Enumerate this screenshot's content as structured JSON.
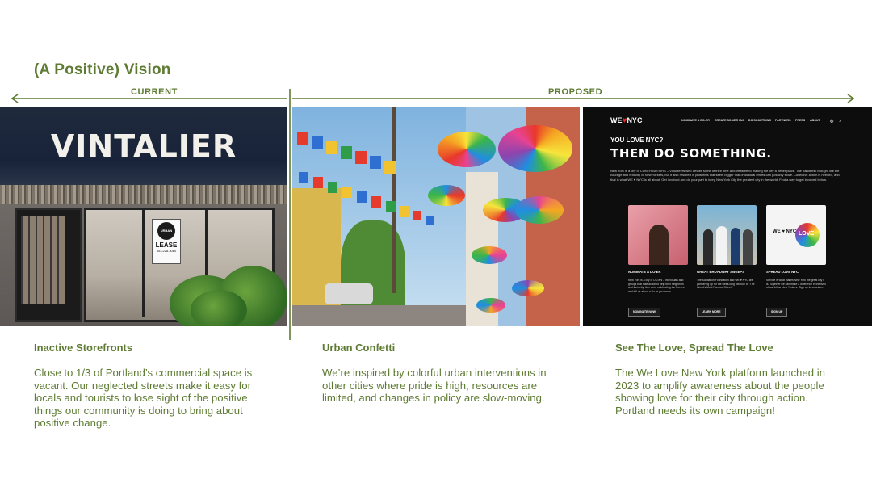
{
  "title": "(A Positive) Vision",
  "labels": {
    "current": "CURRENT",
    "proposed": "PROPOSED"
  },
  "storefront": {
    "sign": "VINTALIER",
    "lease_sign": {
      "logo": "URBAN WORKS",
      "text": "LEASE",
      "phone": "503.228.3060"
    }
  },
  "website": {
    "logo": "WE",
    "logo_heart": "♥",
    "logo_city": "NYC",
    "nav": [
      "NOMINATE A DO-ER",
      "CREATE SOMETHING",
      "DO SOMETHING",
      "PARTNERS",
      "PRESS",
      "ABOUT"
    ],
    "heading_small": "YOU LOVE NYC?",
    "heading_large": "THEN DO SOMETHING.",
    "body": "New York is a city of CONTRIBUTORS – Volunteers who devote some of their time and treasure to making the city a better place. The pandemic brought out the courage and tenacity of New Yorkers, but it also resulted in problems that seem bigger than individual efforts can possibly solve. Collective action is needed, and that is what WE ♥ NYC is all about. Get involved and do your part to keep New York City the greatest city in the world. Find a way to get involved below.",
    "cards": [
      {
        "title": "NOMINATE A DO-ER",
        "text": "New York is a city of DO-ers – individuals and groups that take action to help their neighbors and their city. Join us in celebrating the Do-ers and tell us about a Do-er you know.",
        "button": "NOMINATE NOW"
      },
      {
        "title": "GREAT BROADWAY SWEEPS",
        "text": "The Sanitation Foundation and WE ♥ NYC are partnering up for the week-long cleanup of \"The World's Most Famous Street.\"",
        "button": "LEARN MORE"
      },
      {
        "title": "SPREAD LOVE NYC",
        "text": "Service is what makes New York the great city it is. Together we can make a difference in the lives of our fellow New Yorkers. Sign up to volunteer.",
        "button": "SIGN UP"
      }
    ],
    "card_logo": "WE ♥ NYC",
    "card_love": "LOVE"
  },
  "sections": [
    {
      "title": "Inactive Storefronts",
      "body": "Close to 1/3 of Portland’s commercial space is vacant. Our neglected streets make it easy for locals and tourists to lose sight of the positive things our community is doing to bring about positive change."
    },
    {
      "title": "Urban Confetti",
      "body": "We’re inspired by colorful urban interventions in other cities where pride is high, resources are limited, and changes in policy are slow-moving."
    },
    {
      "title": "See The Love, Spread The Love",
      "body": "The We Love New York platform launched in 2023 to amplify awareness about the people showing love for their city through action. Portland needs its own campaign!"
    }
  ],
  "colors": {
    "accent": "#5e7b33",
    "web_bg": "#0d0d0d",
    "heart": "#e3262a"
  }
}
